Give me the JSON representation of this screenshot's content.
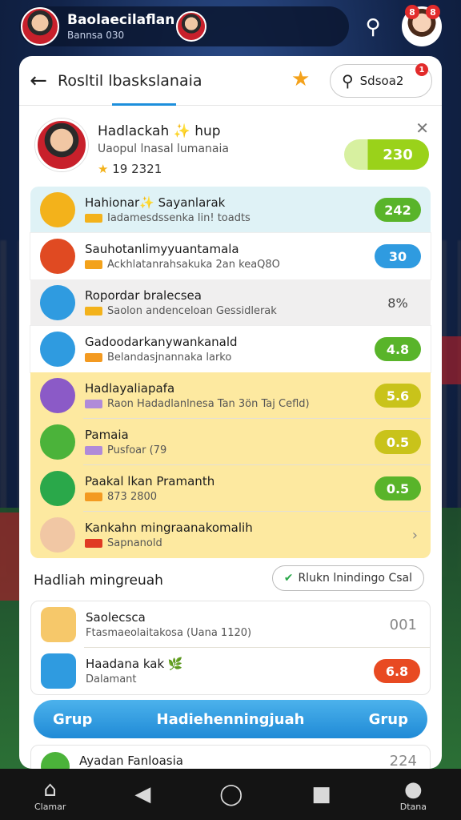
{
  "topbar": {
    "title": "Baolaecilaflan",
    "subtitle": "Bannsa 030",
    "notif_count": "8"
  },
  "header": {
    "title": "Rosltil lbaskslanaia",
    "search_label": "Sdsoa2",
    "search_badge": "1"
  },
  "profile": {
    "name": "Hadlackah ✨ hup",
    "subtitle": "Uaopul lnasal lumanaia",
    "score": "19  2321",
    "pill_value": "230"
  },
  "rows": [
    {
      "title": "Hahionar✨ Sayanlarak",
      "sub": "Iadamesdssenka lin! toadts",
      "badge": "242",
      "badge_color": "#59b42a",
      "icon_color": "#f3b21b",
      "mark": "#f3b21b"
    },
    {
      "title": "Sauhotanlimyyuantamala",
      "sub": "Ackhlatanrahsakuka 2an keaQ8O",
      "badge": "30",
      "badge_color": "#2f9be0",
      "icon_color": "#e04a22",
      "mark": "#f3a21b"
    },
    {
      "title": "Ropordar bralecsea",
      "sub": "Saolon andenceloan Gessidlerak",
      "badge": "8%",
      "badge_color": "none",
      "icon_color": "#2f9be0",
      "mark": "#f3b21b"
    },
    {
      "title": "Gadoodarkanywankanald",
      "sub": "Belandasjnannaka larko",
      "badge": "4.8",
      "badge_color": "#59b42a",
      "icon_color": "#2f9be0",
      "mark": "#f39a21"
    },
    {
      "title": "Hadlayaliapafa",
      "sub": "Raon Hadadlanlnesa Tan 3ön Taj Cefld)",
      "badge": "5.6",
      "badge_color": "#c9c31a",
      "icon_color": "#8b5ac7",
      "mark": "#b08bd9"
    },
    {
      "title": "Pamaia",
      "sub": "Pusfoar (79",
      "badge": "0.5",
      "badge_color": "#c9c31a",
      "icon_color": "#4bb33a",
      "mark": "#b08bd9"
    },
    {
      "title": "Paakal lkan Pramanth",
      "sub": "873 2800",
      "badge": "0.5",
      "badge_color": "#59b42a",
      "icon_color": "#2aa84a",
      "mark": "#f39a21"
    },
    {
      "title": "Kankahn mingraanakomalih",
      "sub": "Sapnanold",
      "badge": "",
      "badge_color": "none",
      "icon_color": "#f1c7a4",
      "mark": "#e03a22"
    }
  ],
  "section": {
    "title": "Hadliah mingreuah",
    "chip": "Rlukn lnindingo Csal"
  },
  "rows2": [
    {
      "title": "Saolecsca",
      "sub": "Ftasmaeolaitakosa (Uana 1120)",
      "value": "001",
      "icon_color": "#f6c86a"
    },
    {
      "title": "Haadana kak 🌿",
      "sub": "Dalamant",
      "value": "6.8",
      "value_color": "#e84a22",
      "icon_color": "#2f9be0"
    }
  ],
  "group_button": {
    "left": "Grup",
    "center": "Hadiehenningjuah",
    "right": "Grup"
  },
  "last_row": {
    "title": "Ayadan Fanloasia",
    "value": "224"
  },
  "nav": {
    "home_label": "Clamar",
    "profile_label": "Dtana"
  }
}
